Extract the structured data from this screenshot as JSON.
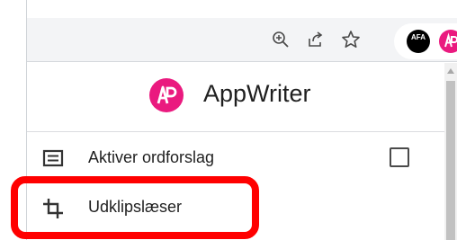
{
  "browser_toolbar": {
    "icons": [
      "zoom-in-icon",
      "share-icon",
      "bookmark-star-icon"
    ],
    "extensions": {
      "afa": {
        "text": "AFA"
      },
      "appwriter": {
        "icon": "appwriter-icon"
      }
    }
  },
  "popup": {
    "app_name": "AppWriter",
    "brand_color": "#ea1a7f",
    "menu": {
      "word_suggestions": {
        "label": "Aktiver ordforslag",
        "icon": "text-lines-icon",
        "checked": false
      },
      "clipboard_reader": {
        "label": "Udklipslæser",
        "icon": "crop-icon"
      }
    }
  },
  "annotation": {
    "color": "#ff0000"
  }
}
